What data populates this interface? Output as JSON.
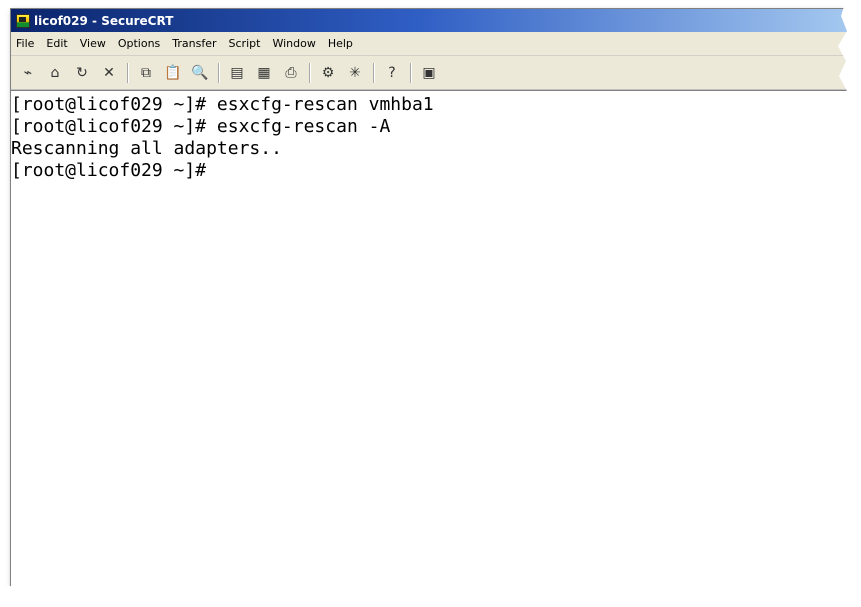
{
  "window": {
    "title": "licof029 - SecureCRT",
    "title_icon": "securecrt-app-icon",
    "accent_color": "#0a246a",
    "border_color": "#808080"
  },
  "menu": [
    {
      "label": "File"
    },
    {
      "label": "Edit"
    },
    {
      "label": "View"
    },
    {
      "label": "Options"
    },
    {
      "label": "Transfer"
    },
    {
      "label": "Script"
    },
    {
      "label": "Window"
    },
    {
      "label": "Help"
    }
  ],
  "toolbar": {
    "buttons": [
      {
        "name": "connect-icon",
        "glyph": "⌁"
      },
      {
        "name": "quick-connect-icon",
        "glyph": "⌂"
      },
      {
        "name": "reconnect-icon",
        "glyph": "↻"
      },
      {
        "name": "disconnect-icon",
        "glyph": "✕"
      },
      {
        "name": "copy-icon",
        "glyph": "⧉"
      },
      {
        "name": "paste-icon",
        "glyph": "📋"
      },
      {
        "name": "find-icon",
        "glyph": "🔍"
      },
      {
        "name": "session-options-icon",
        "glyph": "▤"
      },
      {
        "name": "global-options-icon",
        "glyph": "▦"
      },
      {
        "name": "print-icon",
        "glyph": "⎙"
      },
      {
        "name": "properties-icon",
        "glyph": "⚙"
      },
      {
        "name": "map-keys-icon",
        "glyph": "✳"
      },
      {
        "name": "help-icon",
        "glyph": "?"
      },
      {
        "name": "keymap-icon",
        "glyph": "▣"
      }
    ]
  },
  "terminal": {
    "lines": [
      "[root@licof029 ~]# esxcfg-rescan vmhba1",
      "[root@licof029 ~]# esxcfg-rescan -A",
      "Rescanning all adapters..",
      "[root@licof029 ~]#"
    ],
    "background_color": "#ffffff",
    "text_color": "#000000"
  }
}
